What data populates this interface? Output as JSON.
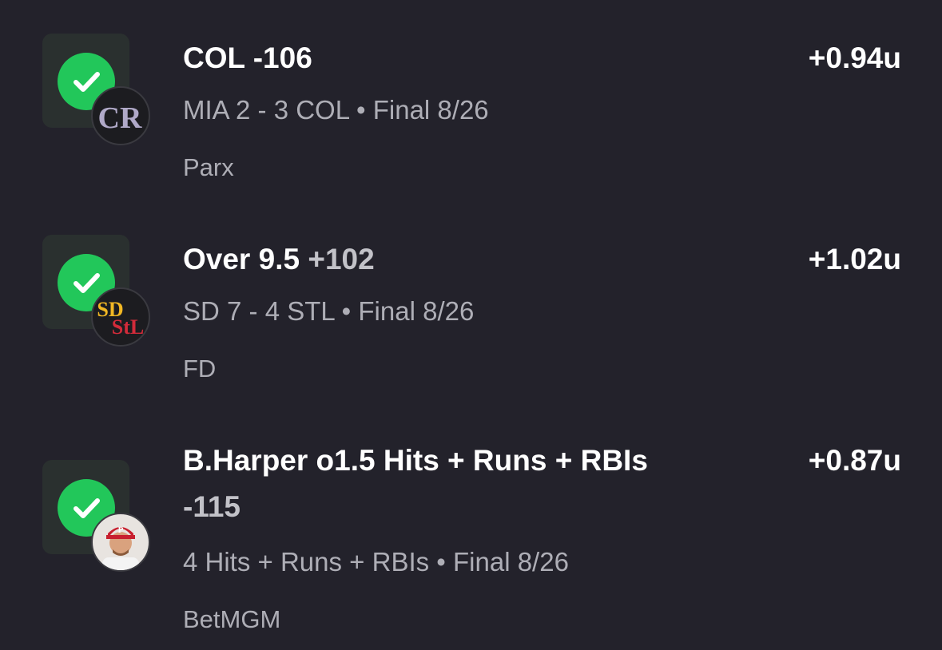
{
  "bets": [
    {
      "title": "COL -106",
      "odds": "",
      "odds_line2": "",
      "units": "+0.94u",
      "result": "MIA 2 - 3 COL • Final 8/26",
      "book": "Parx",
      "status": "won",
      "badge": "rockies-logo",
      "badge_text": "CR"
    },
    {
      "title": "Over 9.5",
      "odds": "+102",
      "odds_line2": "",
      "units": "+1.02u",
      "result": "SD 7 - 4 STL • Final 8/26",
      "book": "FD",
      "status": "won",
      "badge": "padres-cardinals-logo",
      "badge_text": "SD STL"
    },
    {
      "title": "B.Harper o1.5 Hits + Runs + RBIs",
      "odds": "",
      "odds_line2": "-115",
      "units": "+0.87u",
      "result": "4 Hits + Runs + RBIs • Final 8/26",
      "book": "BetMGM",
      "status": "won",
      "badge": "player-headshot",
      "badge_text": "P"
    }
  ],
  "colors": {
    "background": "#23222b",
    "win_green": "#22c75a",
    "tile": "#2a302f",
    "secondary_text": "#aeaeb6",
    "odds_text": "#c2c2c8"
  }
}
